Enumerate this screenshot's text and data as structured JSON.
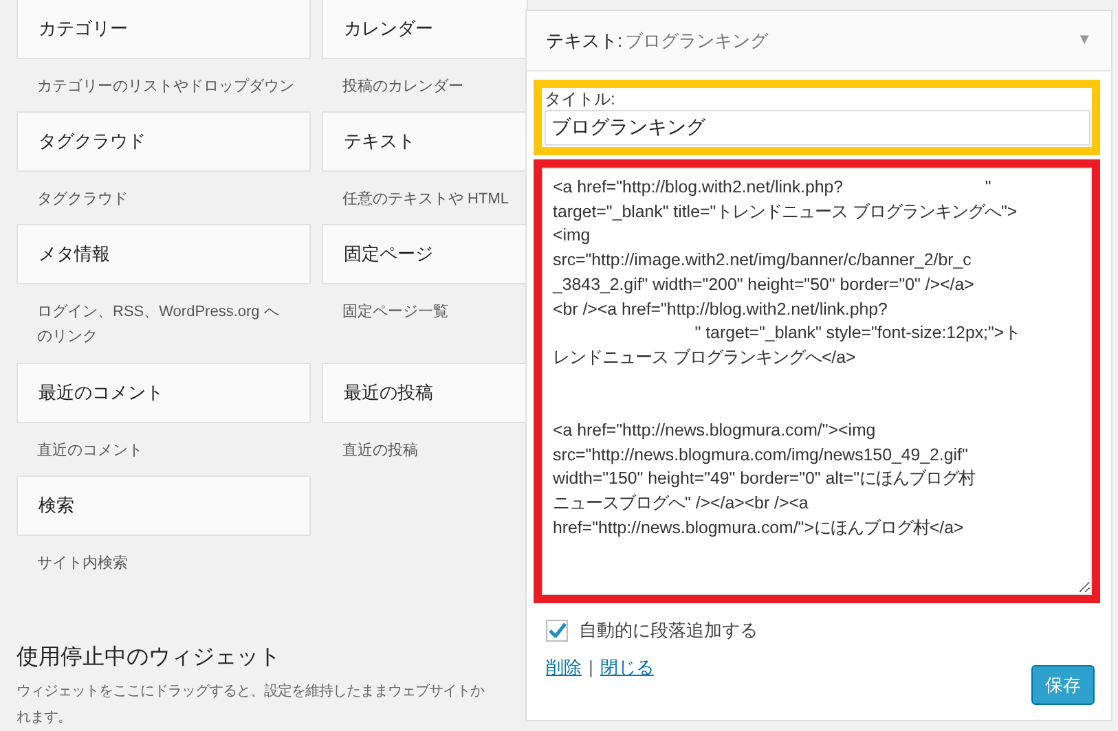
{
  "available_widgets": [
    {
      "title": "カテゴリー",
      "description": "カテゴリーのリストやドロップダウン"
    },
    {
      "title": "カレンダー",
      "description": "投稿のカレンダー"
    },
    {
      "title": "タグクラウド",
      "description": "タグクラウド"
    },
    {
      "title": "テキスト",
      "description": "任意のテキストや HTML"
    },
    {
      "title": "メタ情報",
      "description": "ログイン、RSS、WordPress.org へのリンク"
    },
    {
      "title": "固定ページ",
      "description": "固定ページ一覧"
    },
    {
      "title": "最近のコメント",
      "description": "直近のコメント"
    },
    {
      "title": "最近の投稿",
      "description": "直近の投稿"
    },
    {
      "title": "検索",
      "description": "サイト内検索"
    }
  ],
  "inactive_section": {
    "heading": "使用停止中のウィジェット",
    "description_lines": [
      "ウィジェットをここにドラッグすると、設定を維持したままウェブサイトか",
      "れます。"
    ]
  },
  "widget_panel": {
    "type_label": "テキスト:",
    "title": "ブログランキング",
    "toggle": "▼",
    "title_label": "タイトル:",
    "title_value": "ブログランキング",
    "content_blocks": [
      [
        "<a href=\"http://blog.with2.net/link.php?                              \"",
        "target=\"_blank\" title=\"トレンドニュース ブログランキングへ\">",
        "<img",
        "src=\"http://image.with2.net/img/banner/c/banner_2/br_c",
        "_3843_2.gif\" width=\"200\" height=\"50\" border=\"0\" /></a>",
        "<br /><a href=\"http://blog.with2.net/link.php?",
        "                              \" target=\"_blank\" style=\"font-size:12px;\">ト",
        "レンドニュース ブログランキングへ</a>"
      ],
      [
        "<a href=\"http://news.blogmura.com/\"><img",
        "src=\"http://news.blogmura.com/img/news150_49_2.gif\"",
        "width=\"150\" height=\"49\" border=\"0\" alt=\"にほんブログ村",
        "ニュースブログへ\" /></a><br /><a",
        "href=\"http://news.blogmura.com/\">にほんブログ村</a>"
      ]
    ],
    "auto_paragraph": {
      "label": "自動的に段落追加する",
      "checked": true
    },
    "links": [
      "削除",
      "閉じる"
    ],
    "separator": "|",
    "save_button": "保存"
  }
}
